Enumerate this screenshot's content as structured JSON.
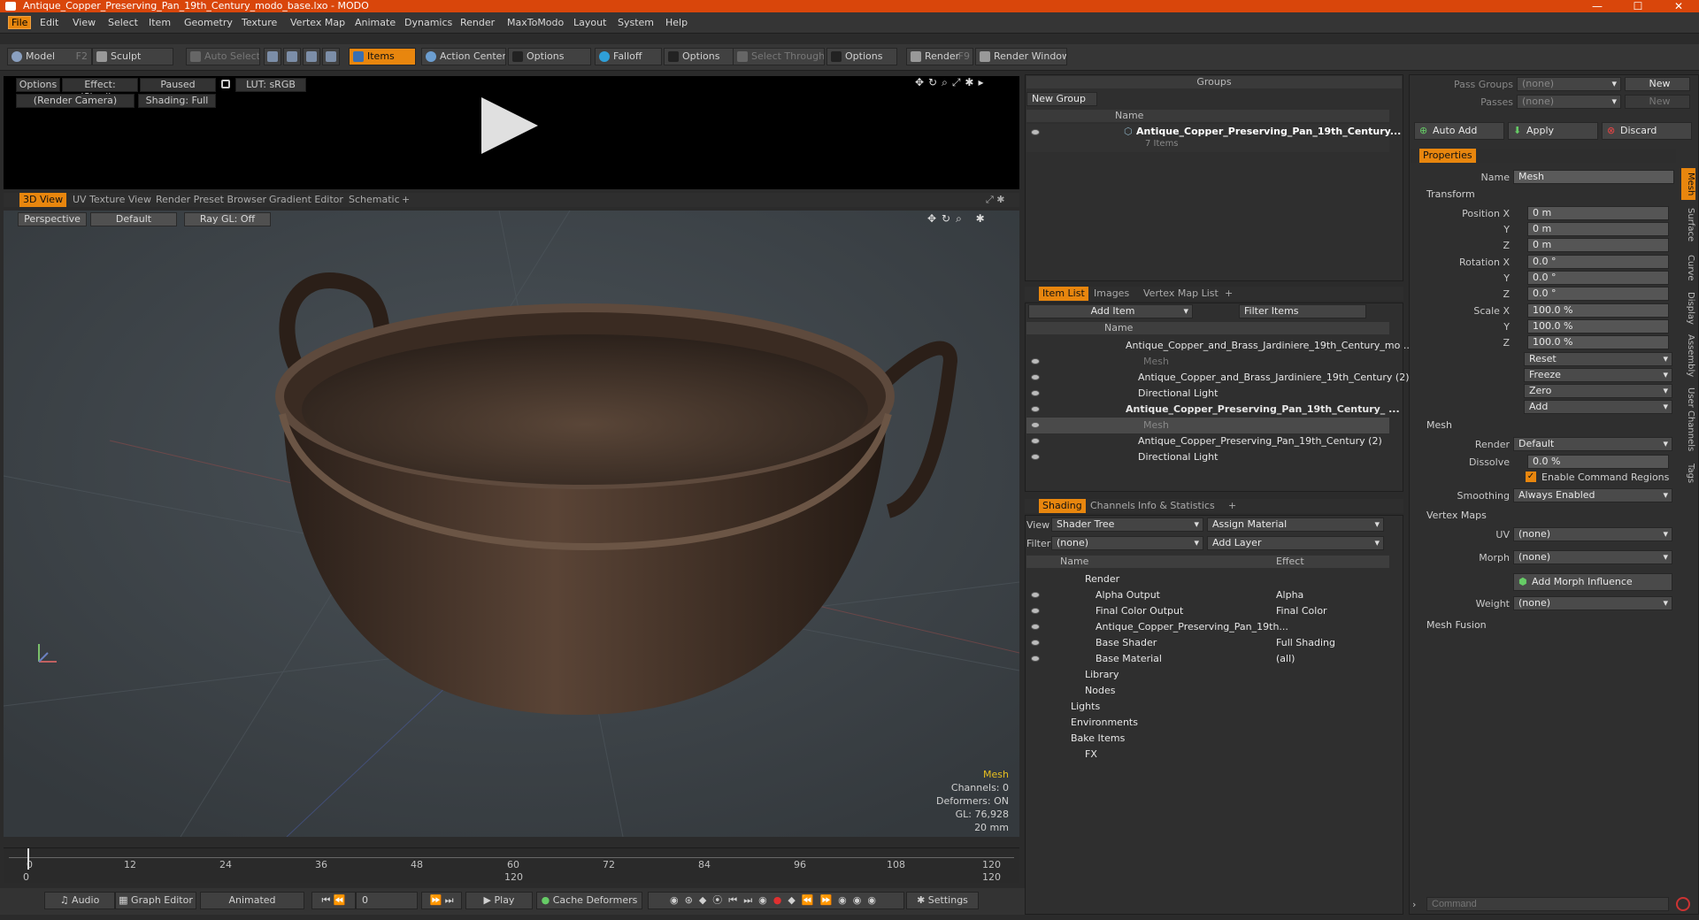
{
  "window": {
    "title": "Antique_Copper_Preserving_Pan_19th_Century_modo_base.lxo - MODO",
    "minimize": "—",
    "maximize": "☐",
    "close": "✕"
  },
  "menu": [
    "File",
    "Edit",
    "View",
    "Select",
    "Item",
    "Geometry",
    "Texture",
    "Vertex Map",
    "Animate",
    "Dynamics",
    "Render",
    "MaxToModo",
    "Layout",
    "System",
    "Help"
  ],
  "toolbar": {
    "model": "Model",
    "model_key": "F2",
    "sculpt": "Sculpt",
    "auto_select": "Auto Select",
    "items": "Items",
    "action_center": "Action Center",
    "options1": "Options",
    "falloff": "Falloff",
    "options2": "Options",
    "select_through": "Select Through",
    "options3": "Options",
    "render": "Render",
    "render_key": "F9",
    "render_window": "Render Window"
  },
  "preview": {
    "options": "Options",
    "effect": "Effect: (Shadi...",
    "paused": "Paused",
    "lut": "LUT: sRGB",
    "camera": "(Render Camera)",
    "shading": "Shading: Full"
  },
  "viewport_tabs": [
    "3D View",
    "UV Texture View",
    "Render Preset Browser",
    "Gradient Editor",
    "Schematic",
    "+"
  ],
  "viewport": {
    "perspective": "Perspective",
    "default": "Default",
    "raygl": "Ray GL: Off",
    "stats": {
      "item": "Mesh",
      "channels": "Channels: 0",
      "deformers": "Deformers: ON",
      "gl": "GL: 76,928",
      "unit": "20 mm"
    }
  },
  "timeline": {
    "ticks": [
      "0",
      "12",
      "24",
      "36",
      "48",
      "60",
      "72",
      "84",
      "96",
      "108",
      "120"
    ],
    "start": "0",
    "mid": "120",
    "end": "120"
  },
  "bottombar": {
    "audio": "Audio",
    "graph_editor": "Graph Editor",
    "animated": "Animated",
    "frame": "0",
    "play": "Play",
    "cache_deformers": "Cache Deformers",
    "settings": "Settings"
  },
  "groups": {
    "title": "Groups",
    "new_group": "New Group",
    "col_name": "Name",
    "item": "Antique_Copper_Preserving_Pan_19th_Century...",
    "item_sub": "7 Items"
  },
  "itemlist": {
    "tabs": [
      "Item List",
      "Images",
      "Vertex Map List",
      "+"
    ],
    "add_item": "Add Item",
    "filter": "Filter Items",
    "col_name": "Name",
    "rows": [
      "Antique_Copper_and_Brass_Jardiniere_19th_Century_mo ...",
      "Mesh",
      "Antique_Copper_and_Brass_Jardiniere_19th_Century (2)",
      "Directional Light",
      "Antique_Copper_Preserving_Pan_19th_Century_ ...",
      "Mesh",
      "Antique_Copper_Preserving_Pan_19th_Century (2)",
      "Directional Light"
    ]
  },
  "shading": {
    "tabs": [
      "Shading",
      "Channels",
      "Info & Statistics",
      "+"
    ],
    "view_label": "View",
    "view": "Shader Tree",
    "assign": "Assign Material",
    "filter_label": "Filter",
    "filter": "(none)",
    "add_layer": "Add Layer",
    "col_name": "Name",
    "col_effect": "Effect",
    "rows": [
      {
        "name": "Render",
        "effect": ""
      },
      {
        "name": "Alpha Output",
        "effect": "Alpha"
      },
      {
        "name": "Final Color Output",
        "effect": "Final Color"
      },
      {
        "name": "Antique_Copper_Preserving_Pan_19th...",
        "effect": ""
      },
      {
        "name": "Base Shader",
        "effect": "Full Shading"
      },
      {
        "name": "Base Material",
        "effect": "(all)"
      },
      {
        "name": "Library",
        "effect": ""
      },
      {
        "name": "Nodes",
        "effect": ""
      },
      {
        "name": "Lights",
        "effect": ""
      },
      {
        "name": "Environments",
        "effect": ""
      },
      {
        "name": "Bake Items",
        "effect": ""
      },
      {
        "name": "FX",
        "effect": ""
      }
    ]
  },
  "passes": {
    "pass_groups": "Pass Groups",
    "passes": "Passes",
    "none1": "(none)",
    "none2": "(none)",
    "new1": "New",
    "new2": "New",
    "auto_add": "Auto Add",
    "apply": "Apply",
    "discard": "Discard"
  },
  "properties": {
    "tab": "Properties",
    "name_label": "Name",
    "name": "Mesh",
    "transform": "Transform",
    "pos_label": "Position X",
    "px": "0 m",
    "py": "0 m",
    "pz": "0 m",
    "rot_label": "Rotation X",
    "rx": "0.0 °",
    "ry": "0.0 °",
    "rz": "0.0 °",
    "scale_label": "Scale X",
    "sx": "100.0 %",
    "sy": "100.0 %",
    "sz": "100.0 %",
    "y": "Y",
    "z": "Z",
    "reset": "Reset",
    "freeze": "Freeze",
    "zero": "Zero",
    "add": "Add",
    "mesh": "Mesh",
    "render_label": "Render",
    "render": "Default",
    "dissolve_label": "Dissolve",
    "dissolve": "0.0 %",
    "enable_cmd": "Enable Command Regions",
    "smoothing_label": "Smoothing",
    "smoothing": "Always Enabled",
    "vertex_maps": "Vertex Maps",
    "uv_label": "UV",
    "uv": "(none)",
    "morph_label": "Morph",
    "morph": "(none)",
    "add_morph": "Add Morph Influence",
    "weight_label": "Weight",
    "weight": "(none)",
    "mesh_fusion": "Mesh Fusion",
    "vtabs": [
      "Mesh",
      "Surface",
      "Curve",
      "Display",
      "Assembly",
      "User Channels",
      "Tags"
    ]
  },
  "command": {
    "placeholder": "Command"
  },
  "colors": {
    "accent": "#e8860e",
    "titlebar": "#d9460b"
  }
}
